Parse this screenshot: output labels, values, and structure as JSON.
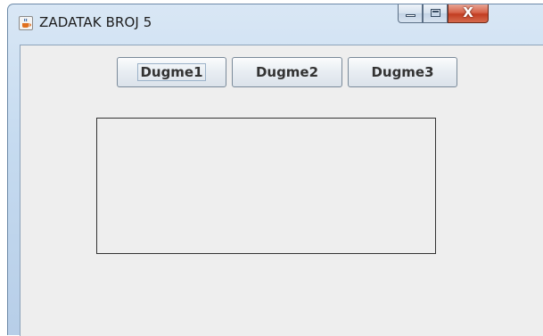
{
  "window": {
    "title": "ZADATAK BROJ 5",
    "icon": "java-coffee-icon",
    "controls": {
      "minimize_icon": "minimize-icon",
      "maximize_icon": "maximize-icon",
      "close_label": "X"
    }
  },
  "buttons": [
    {
      "label": "Dugme1",
      "focused": true
    },
    {
      "label": "Dugme2",
      "focused": false
    },
    {
      "label": "Dugme3",
      "focused": false
    }
  ],
  "colors": {
    "client_background": "#eeeeee",
    "close_button": "#c23d22",
    "panel_border": "#333333"
  }
}
